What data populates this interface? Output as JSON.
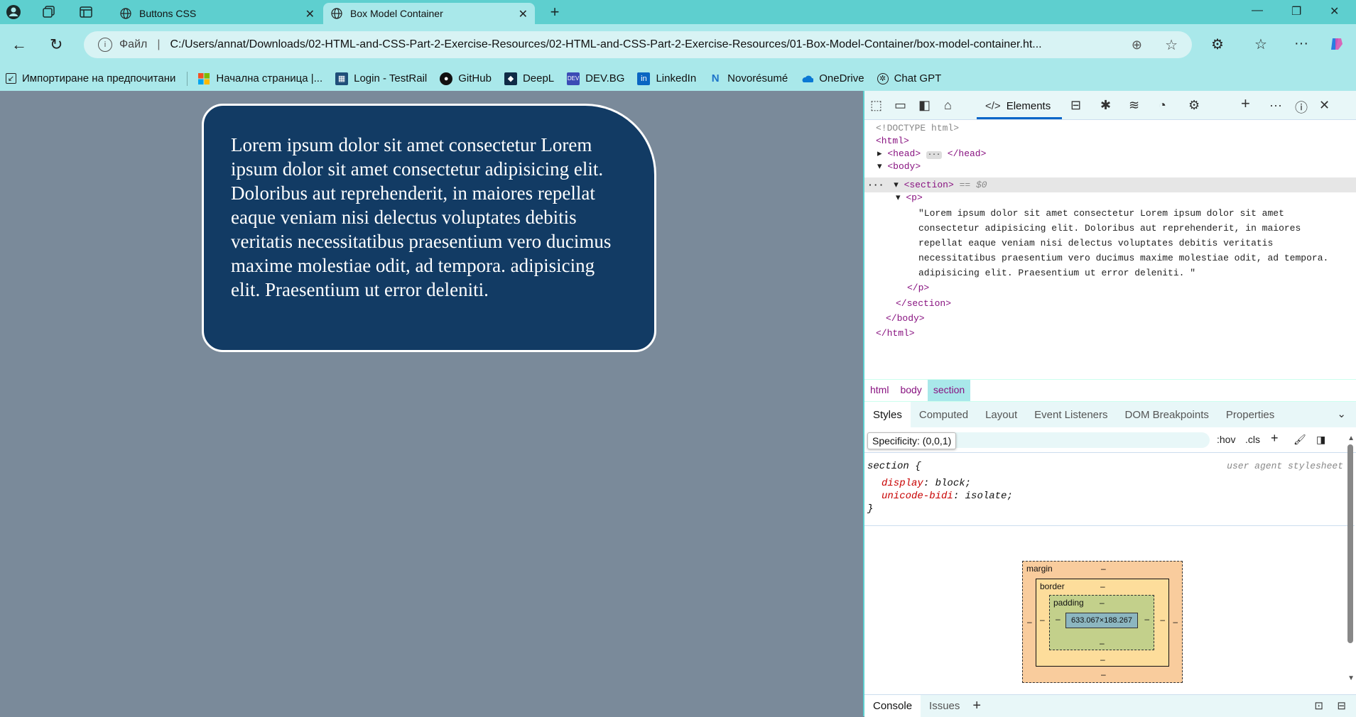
{
  "browser": {
    "tabs": [
      {
        "title": "Buttons CSS",
        "active": false
      },
      {
        "title": "Box Model Container",
        "active": true
      }
    ],
    "address": {
      "scheme_label": "Файл",
      "url": "C:/Users/annat/Downloads/02-HTML-and-CSS-Part-2-Exercise-Resources/02-HTML-and-CSS-Part-2-Exercise-Resources/01-Box-Model-Container/box-model-container.ht..."
    },
    "bookmarks": [
      {
        "label": "Импортиране на предпочитани",
        "icon": "import-icon"
      },
      {
        "label": "Начална страница |...",
        "icon": "microsoft-icon"
      },
      {
        "label": "Login - TestRail",
        "icon": "testrail-icon"
      },
      {
        "label": "GitHub",
        "icon": "github-icon"
      },
      {
        "label": "DeepL",
        "icon": "deepl-icon"
      },
      {
        "label": "DEV.BG",
        "icon": "devbg-icon"
      },
      {
        "label": "LinkedIn",
        "icon": "linkedin-icon"
      },
      {
        "label": "Novorésumé",
        "icon": "novoresume-icon"
      },
      {
        "label": "OneDrive",
        "icon": "onedrive-icon"
      },
      {
        "label": "Chat GPT",
        "icon": "chatgpt-icon"
      }
    ]
  },
  "page": {
    "paragraph": "Lorem ipsum dolor sit amet consectetur Lorem ipsum dolor sit amet consectetur adipisicing elit. Doloribus aut reprehenderit, in maiores repellat eaque veniam nisi delectus voluptates debitis veritatis necessitatibus praesentium vero ducimus maxime molestiae odit, ad tempora. adipisicing elit. Praesentium ut error deleniti.",
    "card_bg": "#123b64",
    "page_bg": "#7a8a9a"
  },
  "devtools": {
    "elements_tab": "Elements",
    "dom": {
      "doctype": "<!DOCTYPE html>",
      "html_open": "<html>",
      "head": "<head>",
      "head_close": "</head>",
      "body_open": "<body>",
      "section_open": "<section>",
      "eq": "== $0",
      "p_open": "<p>",
      "text_lines": [
        "\"Lorem ipsum dolor sit amet consectetur Lorem ipsum dolor sit amet",
        "consectetur adipisicing elit. Doloribus aut reprehenderit, in maiores",
        "repellat eaque veniam nisi delectus voluptates debitis veritatis",
        "necessitatibus praesentium vero ducimus maxime molestiae odit, ad tempora.",
        "adipisicing elit. Praesentium ut error deleniti. \""
      ],
      "p_close": "</p>",
      "section_close": "</section>",
      "body_close": "</body>",
      "html_close": "</html>"
    },
    "breadcrumbs": [
      "html",
      "body",
      "section"
    ],
    "subtabs": [
      "Styles",
      "Computed",
      "Layout",
      "Event Listeners",
      "DOM Breakpoints",
      "Properties"
    ],
    "filter": {
      "tooltip": "Specificity: (0,0,1)",
      "hov": ":hov",
      "cls": ".cls"
    },
    "rule": {
      "selector": "section {",
      "origin": "user agent stylesheet",
      "props": [
        {
          "name": "display",
          "value": "block;"
        },
        {
          "name": "unicode-bidi",
          "value": "isolate;"
        }
      ],
      "close": "}"
    },
    "box_model": {
      "margin_label": "margin",
      "border_label": "border",
      "padding_label": "padding",
      "dash": "–",
      "content_size": "633.067×188.267"
    },
    "drawer": [
      "Console",
      "Issues"
    ]
  }
}
